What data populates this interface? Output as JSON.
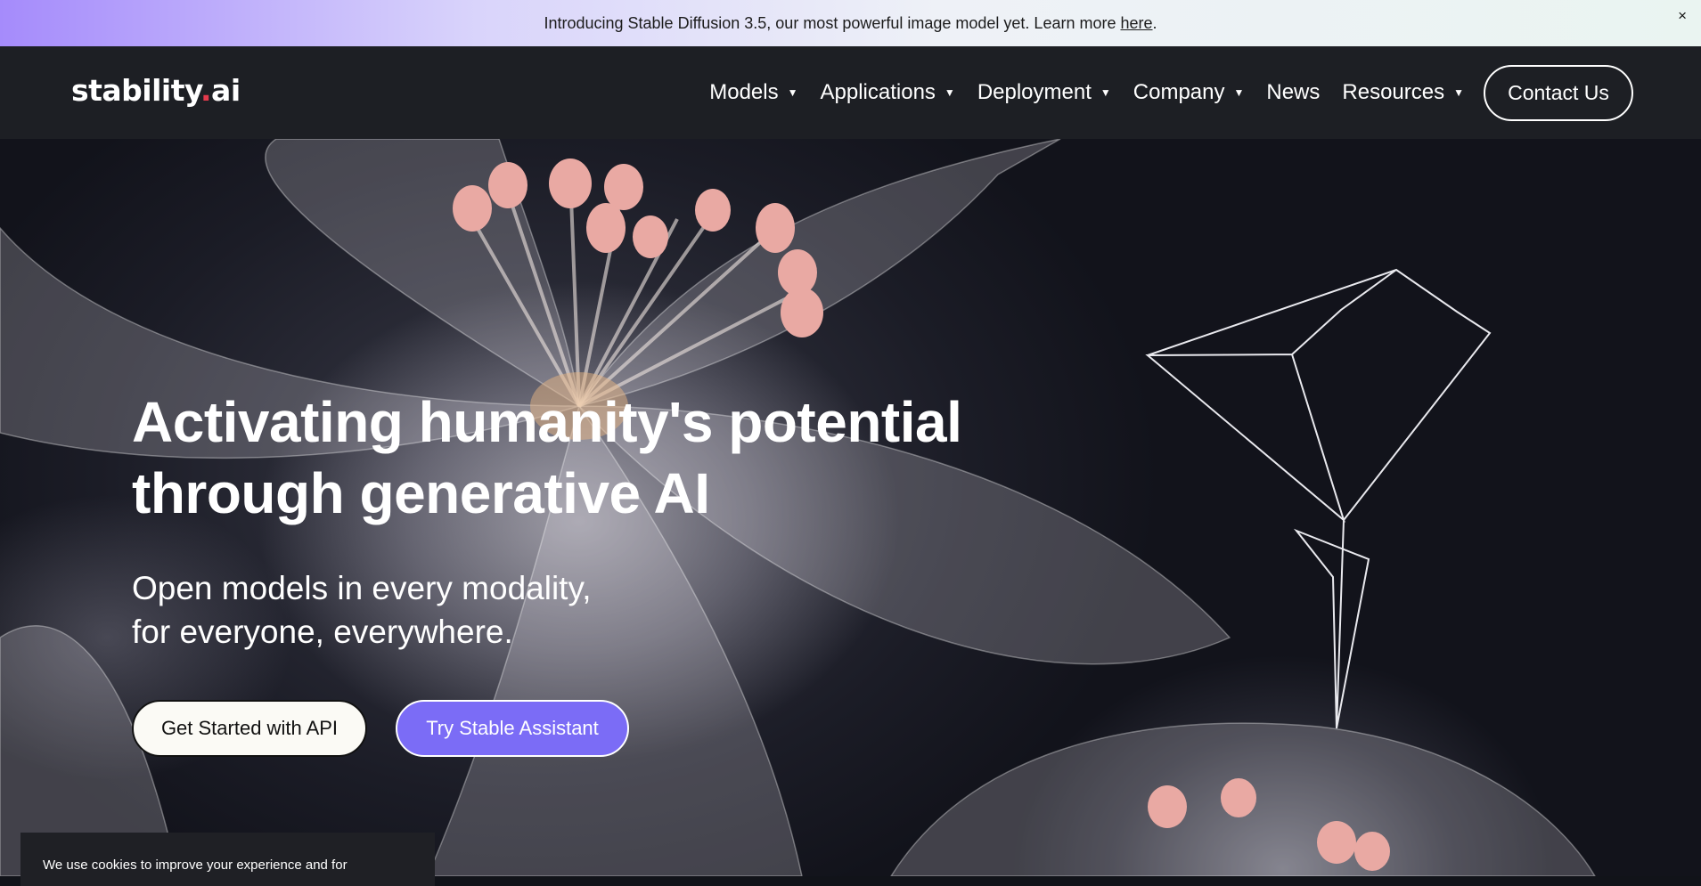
{
  "banner": {
    "text": "Introducing Stable Diffusion 3.5, our most powerful image model yet. Learn more ",
    "link": "here",
    "period": ".",
    "close": "×"
  },
  "nav": {
    "logo_main": "stability",
    "logo_dot": ".",
    "logo_suffix": "ai",
    "items": [
      {
        "label": "Models",
        "caret": "▼"
      },
      {
        "label": "Applications",
        "caret": "▼"
      },
      {
        "label": "Deployment",
        "caret": "▼"
      },
      {
        "label": "Company",
        "caret": "▼"
      },
      {
        "label": "News"
      },
      {
        "label": "Resources",
        "caret": "▼"
      }
    ],
    "contact": "Contact Us"
  },
  "hero": {
    "headline_line1": "Activating humanity's potential",
    "headline_line2": "through generative AI",
    "sub_line1": "Open models in every modality,",
    "sub_line2": "for everyone, everywhere.",
    "primary_button": "Get Started with API",
    "secondary_button": "Try Stable Assistant"
  },
  "cookie": {
    "text": "We use cookies to improve your experience and for"
  },
  "colors": {
    "accent": "#7b6cf6",
    "logo_dot": "#e33a4c",
    "nav_bg": "#1d1f24"
  }
}
